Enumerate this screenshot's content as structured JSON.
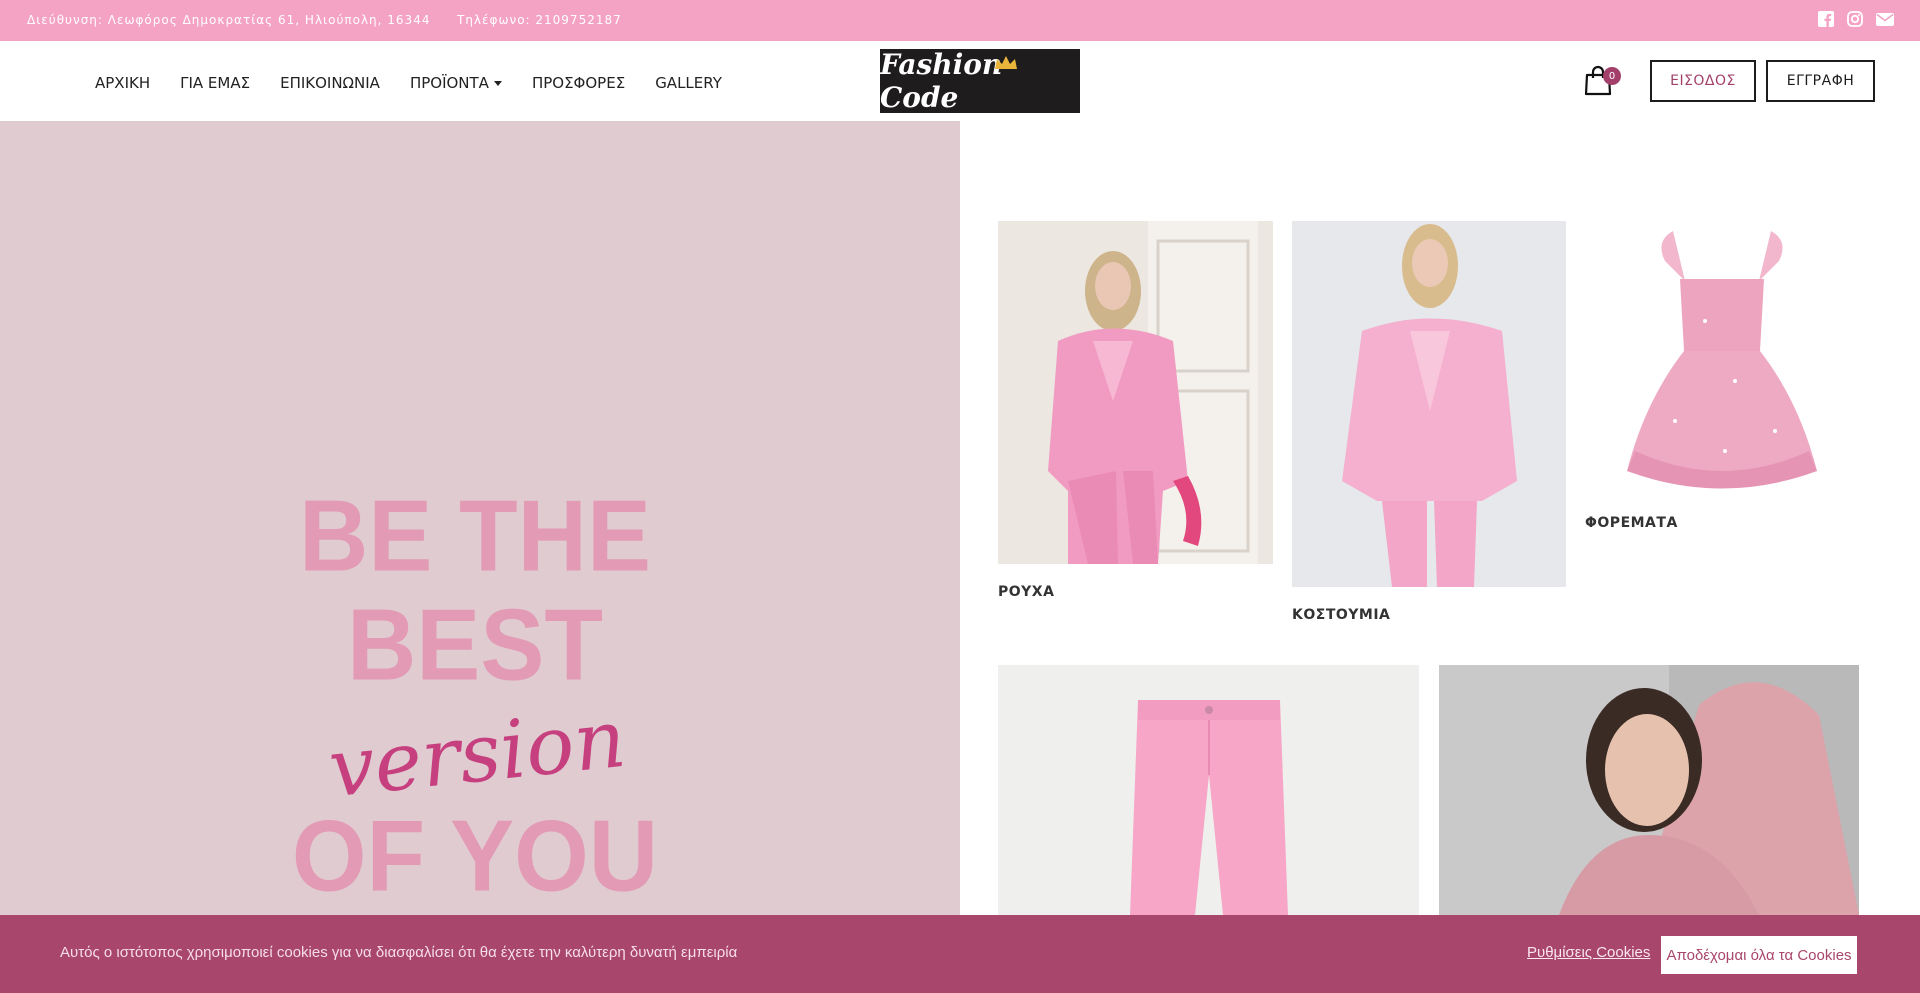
{
  "topbar": {
    "address": "Διεύθυνση: Λεωφόρος Δημοκρατίας 61, Ηλιούπολη, 16344",
    "phone": "Τηλέφωνο: 2109752187",
    "social_icons": [
      "facebook-icon",
      "instagram-icon",
      "mail-icon"
    ]
  },
  "nav": {
    "items": [
      "ΑΡΧΙΚΗ",
      "ΓΙΑ ΕΜΑΣ",
      "ΕΠΙΚΟΙΝΩΝΙΑ",
      "ΠΡΟΪΟΝΤΑ",
      "ΠΡΟΣΦΟΡΕΣ",
      "GALLERY"
    ],
    "logo_text": "Fashion Code",
    "cart_count": "0",
    "login": "ΕΙΣΟΔΟΣ",
    "register": "ΕΓΓΡΑΦΗ"
  },
  "hero": {
    "line1": "BE THE",
    "line2": "BEST",
    "line3": "version",
    "line4": "OF YOU"
  },
  "categories": [
    {
      "label": "ΡΟΥΧΑ"
    },
    {
      "label": "ΚΟΣΤΟΥΜΙΑ"
    },
    {
      "label": "ΦΟΡΕΜΑΤΑ"
    }
  ],
  "cookie": {
    "text": "Αυτός ο ιστότοπος χρησιμοποιεί cookies για να διασφαλίσει ότι θα έχετε την καλύτερη δυνατή εμπειρία",
    "settings": "Ρυθμίσεις Cookies",
    "accept": "Αποδέχομαι όλα τα Cookies"
  },
  "colors": {
    "topbar": "#f4a3c4",
    "accent": "#a3406a",
    "cookie_bg": "#a8466c",
    "hero_bg": "#e0cbd0"
  }
}
